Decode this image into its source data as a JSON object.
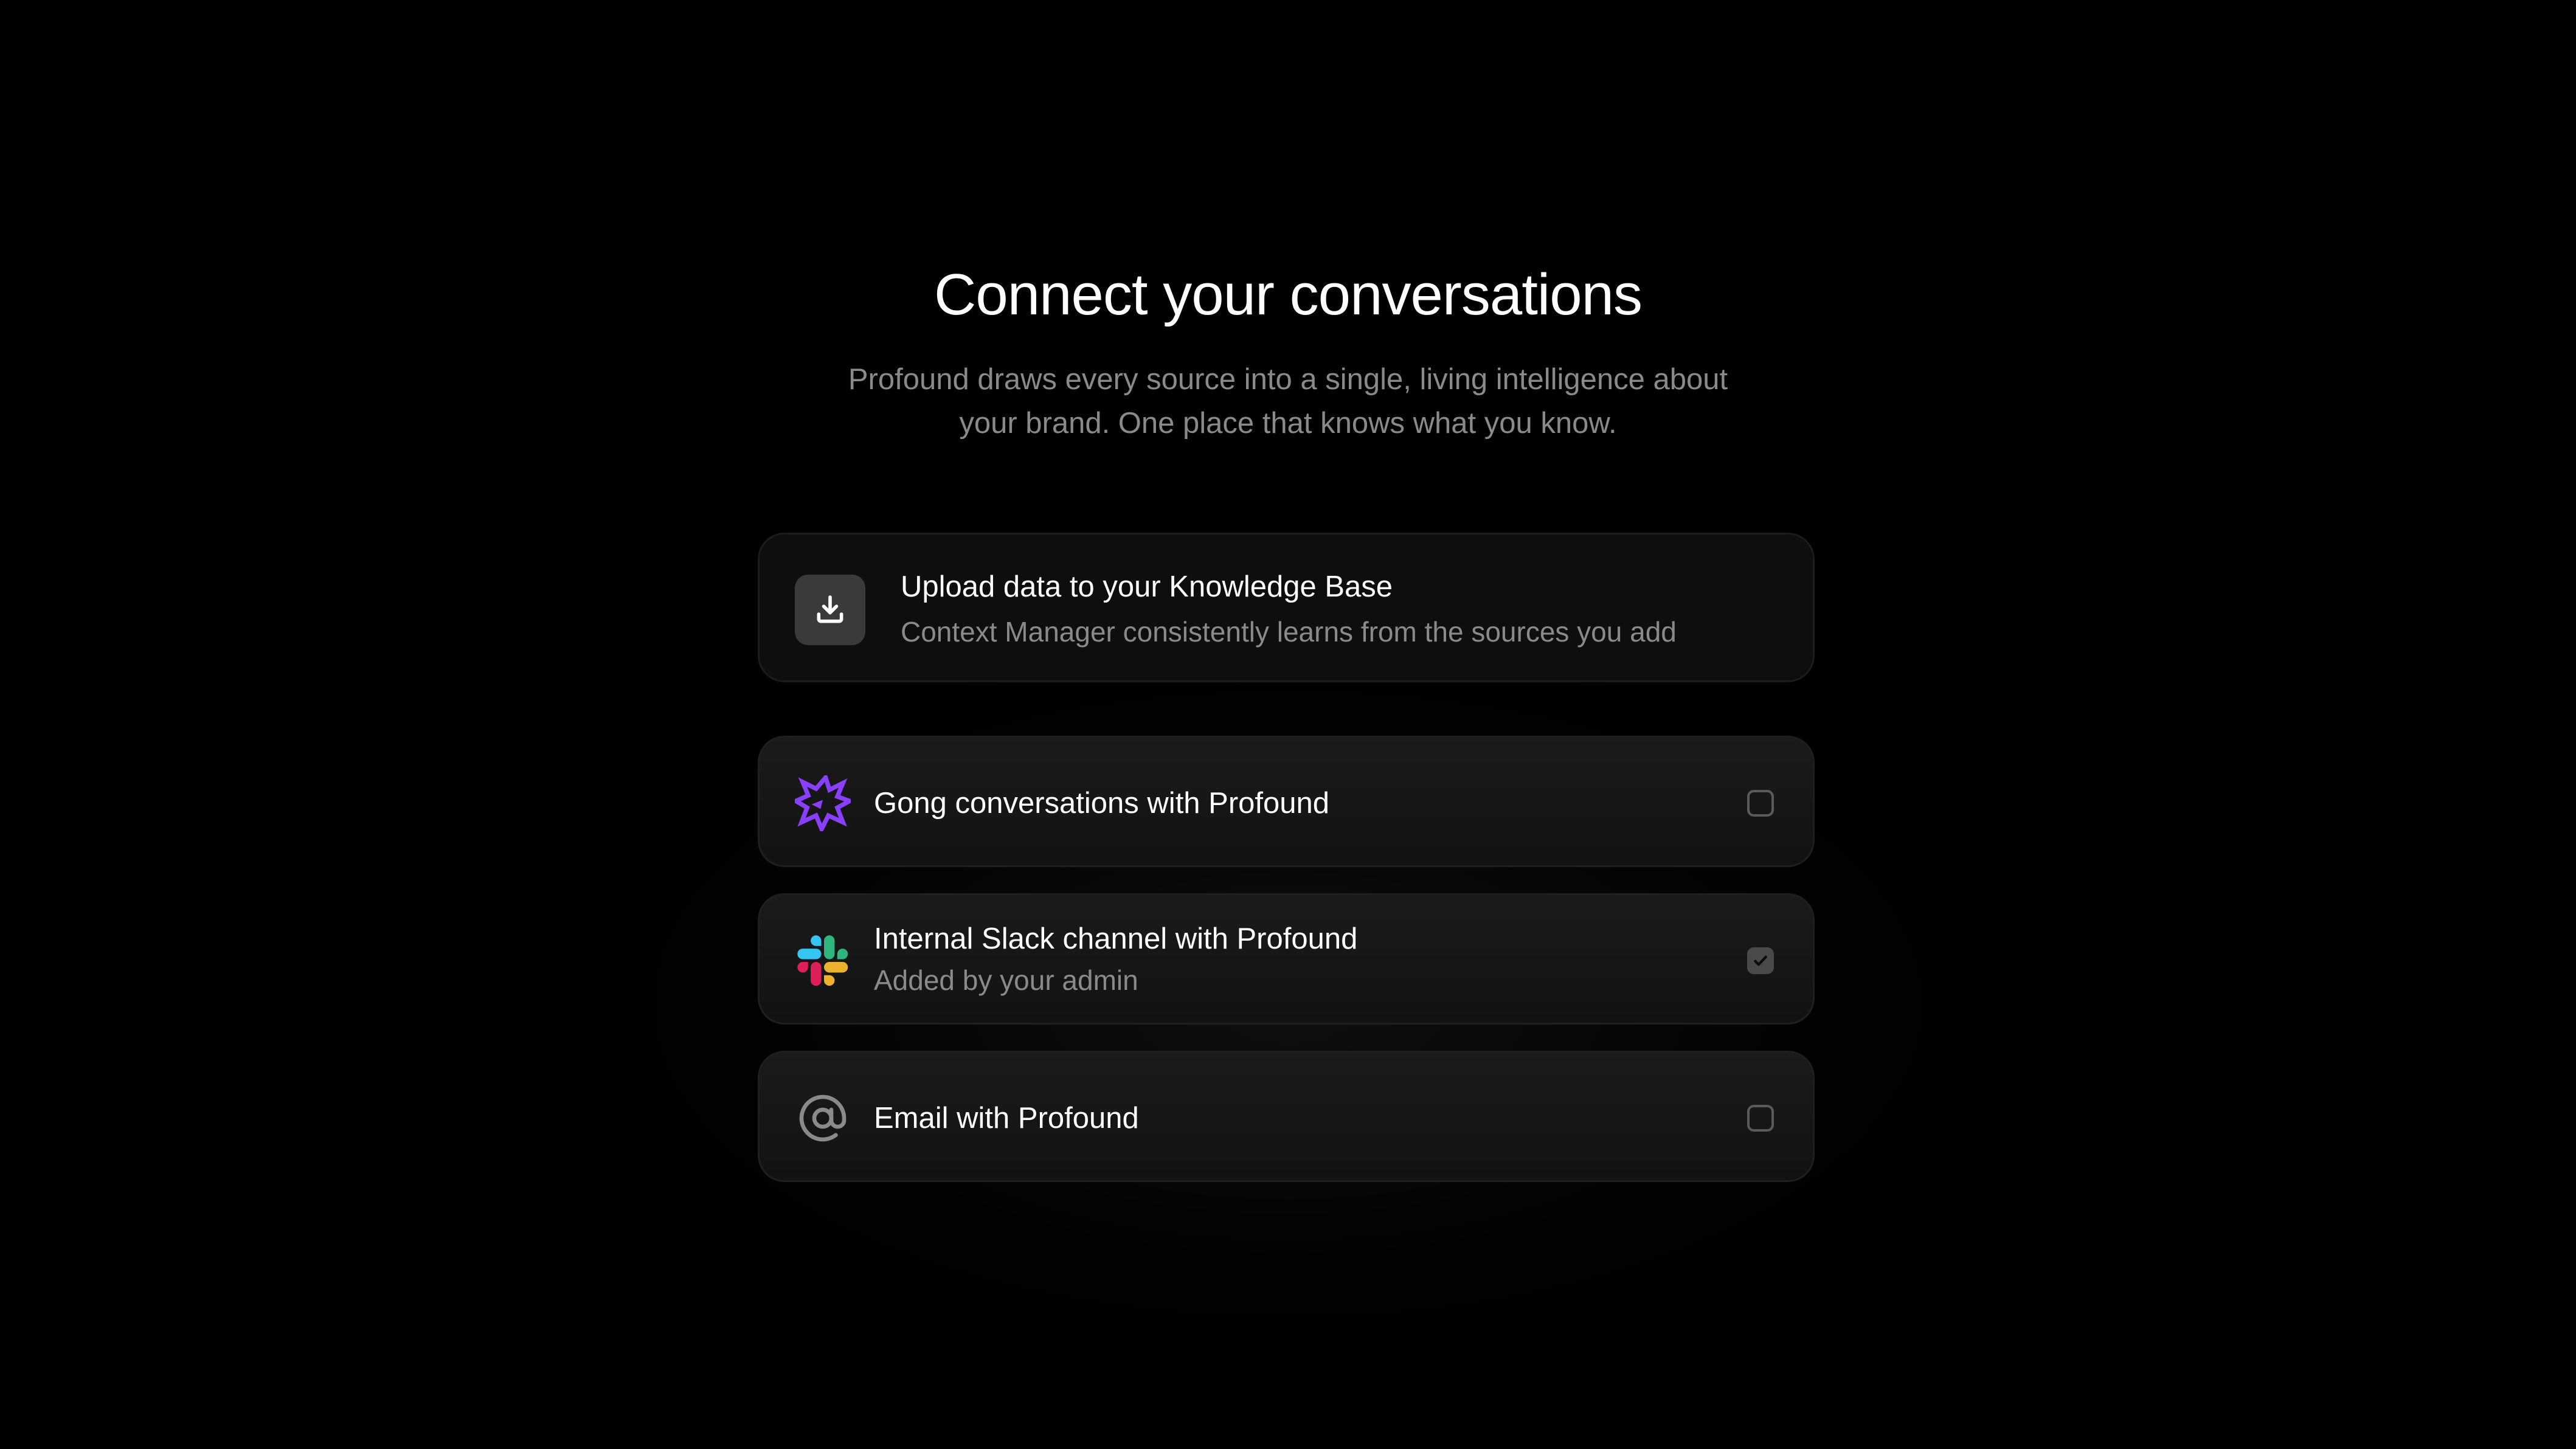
{
  "header": {
    "title": "Connect your conversations",
    "subtitle_line1": "Profound draws every source into a single, living intelligence about",
    "subtitle_line2": "your brand. One place that knows what you know."
  },
  "upload": {
    "icon": "download-icon",
    "title": "Upload data to your Knowledge Base",
    "description": "Context Manager consistently learns from the sources you add"
  },
  "sources": [
    {
      "icon": "gong-icon",
      "label": "Gong conversations with Profound",
      "sublabel": "",
      "checked": false
    },
    {
      "icon": "slack-icon",
      "label": "Internal Slack channel with Profound",
      "sublabel": "Added by your admin",
      "checked": true
    },
    {
      "icon": "at-sign-icon",
      "label": "Email with Profound",
      "sublabel": "",
      "checked": false
    }
  ],
  "colors": {
    "background": "#000000",
    "card": "#171717",
    "muted_text": "#8a8a8a",
    "gong_purple": "#8a3ffc",
    "slack_blue": "#36c5f0",
    "slack_green": "#2eb67d",
    "slack_yellow": "#ecb22e",
    "slack_red": "#e01e5a"
  }
}
